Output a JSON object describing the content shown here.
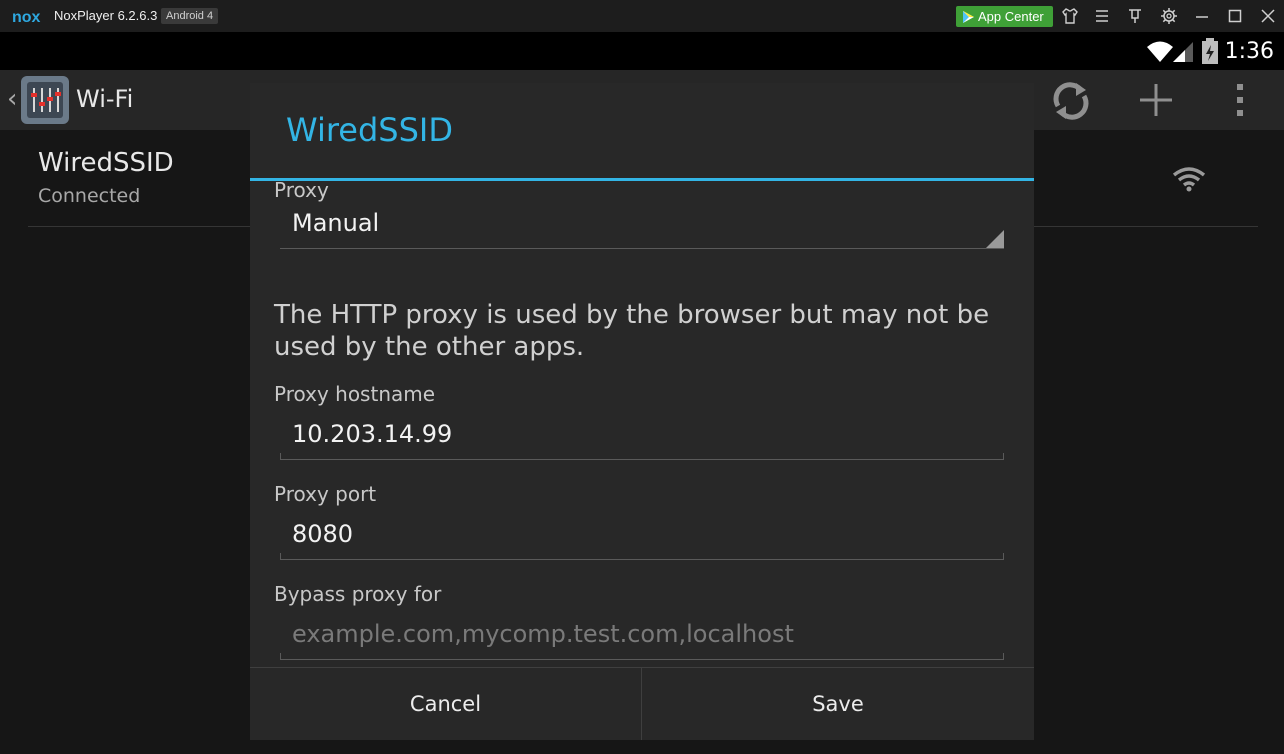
{
  "emulator": {
    "app_name": "NoxPlayer 6.2.6.3",
    "android_badge": "Android 4",
    "app_center_label": "App Center",
    "toolbar_icons": [
      "shirt-icon",
      "menu-icon",
      "pin-icon",
      "gear-icon",
      "minimize-icon",
      "maximize-icon",
      "close-icon"
    ]
  },
  "statusbar": {
    "time": "1:36"
  },
  "settings": {
    "title": "Wi-Fi",
    "network_name": "WiredSSID",
    "network_status": "Connected"
  },
  "dialog": {
    "title": "WiredSSID",
    "proxy_label": "Proxy",
    "proxy_value": "Manual",
    "info_text": "The HTTP proxy is used by the browser but may not be used by the other apps.",
    "hostname_label": "Proxy hostname",
    "hostname_value": "10.203.14.99",
    "port_label": "Proxy port",
    "port_value": "8080",
    "bypass_label": "Bypass proxy for",
    "bypass_placeholder": "example.com,mycomp.test.com,localhost",
    "cancel_label": "Cancel",
    "save_label": "Save"
  },
  "colors": {
    "accent": "#33b5e5",
    "app_center": "#3fa037"
  }
}
